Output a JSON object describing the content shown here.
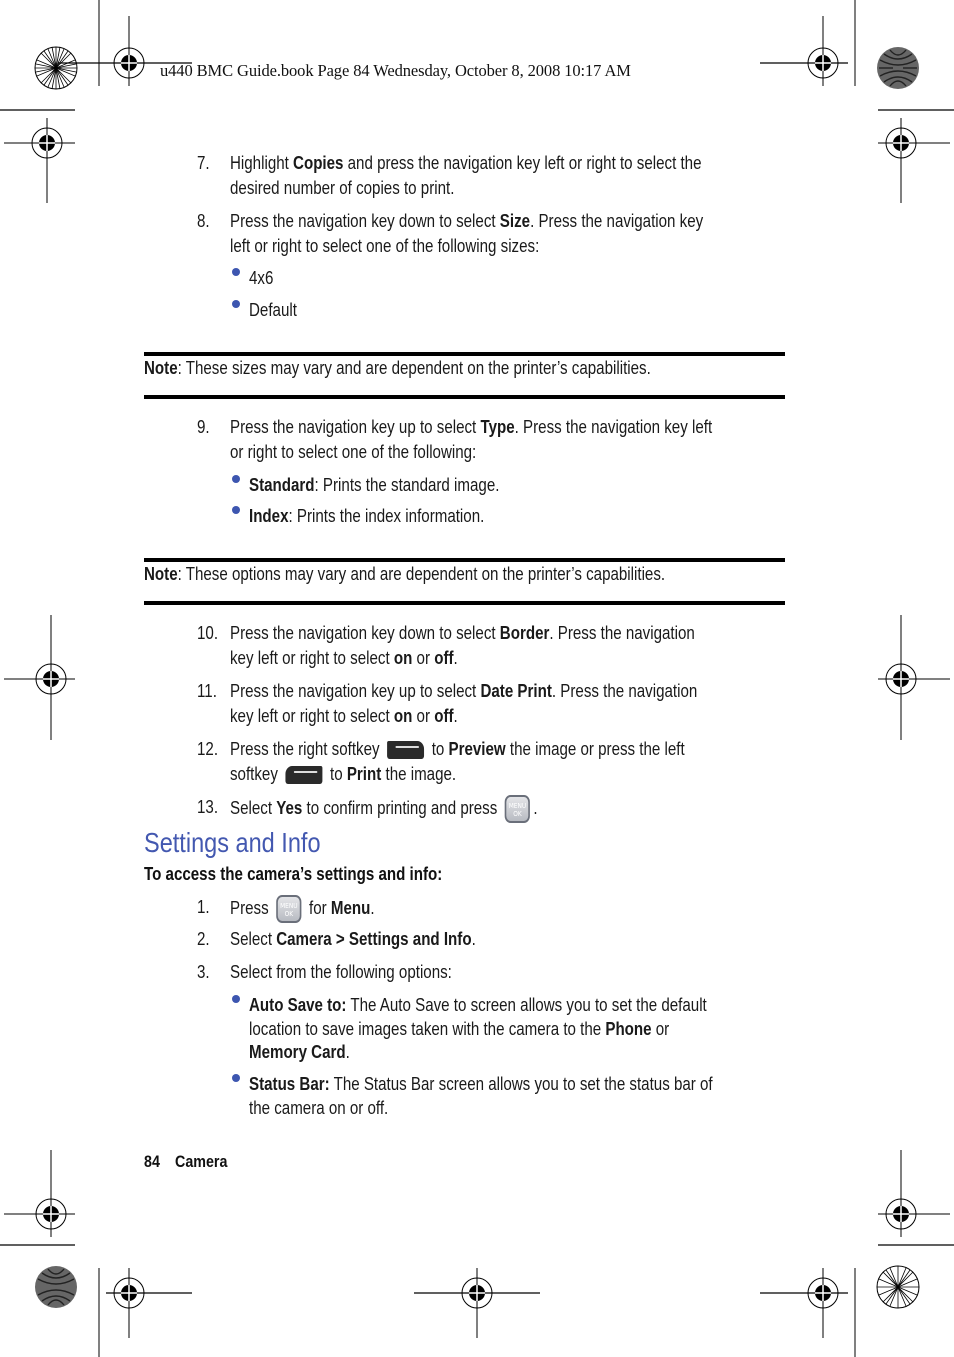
{
  "print_header": "u440 BMC Guide.book  Page 84  Wednesday, October 8, 2008  10:17 AM",
  "steps_a": [
    {
      "num": "7.",
      "line1": [
        {
          "t": "Highlight "
        },
        {
          "b": "Copies"
        },
        {
          "t": " and press the navigation key left or right to select the"
        }
      ],
      "line2": [
        {
          "t": "desired number of copies to print."
        }
      ]
    },
    {
      "num": "8.",
      "line1": [
        {
          "t": "Press the navigation key down to select "
        },
        {
          "b": "Size"
        },
        {
          "t": ". Press the navigation key"
        }
      ],
      "line2": [
        {
          "t": "left or right to select one of the following sizes:"
        }
      ]
    }
  ],
  "sizes": [
    "4x6",
    "Default"
  ],
  "note1": {
    "label": "Note",
    "text": ": These sizes may vary and are dependent on the printer’s capabilities."
  },
  "step9": {
    "num": "9.",
    "line1": [
      {
        "t": "Press the navigation key up to select "
      },
      {
        "b": "Type"
      },
      {
        "t": ". Press the navigation key left"
      }
    ],
    "line2": [
      {
        "t": "or right to select one of the following:"
      }
    ]
  },
  "types": [
    {
      "label": "Standard",
      "text": ": Prints the standard image."
    },
    {
      "label": "Index",
      "text": ": Prints the index information."
    }
  ],
  "note2": {
    "label": "Note",
    "text": ": These options may vary and are dependent on the printer’s capabilities."
  },
  "steps_b": [
    {
      "num": "10.",
      "line1": [
        {
          "t": "Press the navigation key down to select "
        },
        {
          "b": "Border"
        },
        {
          "t": ". Press the navigation"
        }
      ],
      "line2": [
        {
          "t": "key left or right to select "
        },
        {
          "b": "on"
        },
        {
          "t": " or "
        },
        {
          "b": "off"
        },
        {
          "t": "."
        }
      ]
    },
    {
      "num": "11.",
      "line1": [
        {
          "t": "Press the navigation key up to select "
        },
        {
          "b": "Date Print"
        },
        {
          "t": ". Press the navigation"
        }
      ],
      "line2": [
        {
          "t": "key left or right to select "
        },
        {
          "b": "on"
        },
        {
          "t": " or "
        },
        {
          "b": "off"
        },
        {
          "t": "."
        }
      ]
    }
  ],
  "step12": {
    "num": "12.",
    "a": "Press the right softkey",
    "b": "to",
    "c": "Preview",
    "d": "the image or press the left",
    "e": "softkey",
    "f": "to",
    "g": "Print",
    "h": "the image.",
    "icon_right": "right-softkey-icon",
    "icon_left": "left-softkey-icon"
  },
  "step13": {
    "num": "13.",
    "a": "Select",
    "b": "Yes",
    "c": "to confirm printing and press",
    "d": ".",
    "icon": "menu-ok-key-icon"
  },
  "menu_key": {
    "top": "MENU",
    "bottom": "OK"
  },
  "section_heading": "Settings and Info",
  "section_intro": "To access the camera’s settings and info:",
  "step_s1": {
    "num": "1.",
    "a": "Press",
    "b": "for",
    "c": "Menu",
    "d": "."
  },
  "step_s2": {
    "num": "2.",
    "a": "Select ",
    "b": "Camera > Settings and Info",
    "c": "."
  },
  "step_s3": {
    "num": "3.",
    "a": "Select from the following options:"
  },
  "options": [
    {
      "label": "Auto Save to:",
      "line1": " The Auto Save to screen allows you to set the default",
      "line2a": "location to save images taken with the camera to the ",
      "line2b": "Phone",
      "line2c": " or",
      "line3a": "Memory Card",
      "line3b": "."
    },
    {
      "label": "Status Bar:",
      "line1": " The Status Bar screen allows you to set the status bar of",
      "line2": "the camera on or off."
    }
  ],
  "footer": {
    "page": "84",
    "section": "Camera"
  },
  "colors": {
    "heading": "#4358b0",
    "bullet": "#3d56b0"
  }
}
